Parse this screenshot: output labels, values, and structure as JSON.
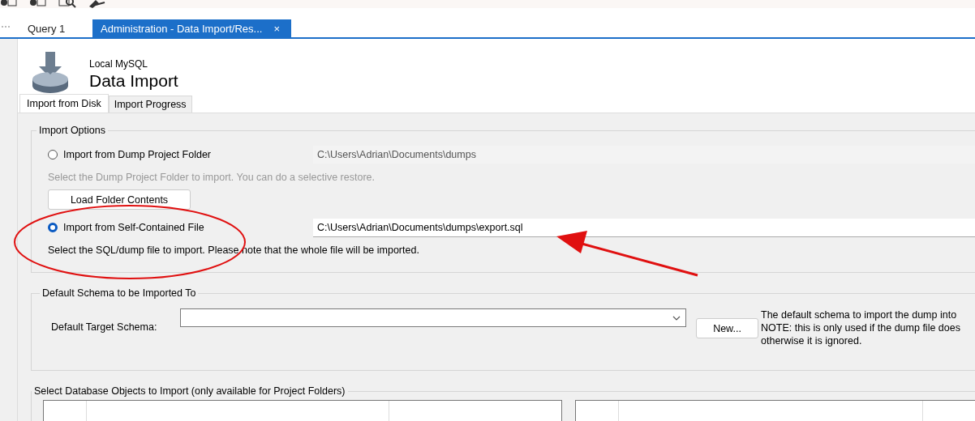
{
  "tabs": [
    {
      "label": "Query 1",
      "selected": false
    },
    {
      "label": "Administration - Data Import/Res...",
      "selected": true,
      "close": "×"
    }
  ],
  "header": {
    "connection": "Local MySQL",
    "title": "Data Import"
  },
  "subtabs": [
    {
      "label": "Import from Disk",
      "selected": true
    },
    {
      "label": "Import Progress",
      "selected": false
    }
  ],
  "import_options": {
    "title": "Import Options",
    "options": [
      {
        "label": "Import from Dump Project Folder",
        "selected": false,
        "path": "C:\\Users\\Adrian\\Documents\\dumps",
        "hint": "Select the Dump Project Folder to import. You can do a selective restore.",
        "button": "Load Folder Contents"
      },
      {
        "label": "Import from Self-Contained File",
        "selected": true,
        "path": "C:\\Users\\Adrian\\Documents\\dumps\\export.sql",
        "hint": "Select the SQL/dump file to import. Please note that the whole file will be imported."
      }
    ]
  },
  "default_schema": {
    "title": "Default Schema to be Imported To",
    "label": "Default Target Schema:",
    "button": "New...",
    "note": [
      "The default schema to import the dump into",
      "NOTE: this is only used if the dump file does",
      "otherwise it is ignored."
    ]
  },
  "objects": {
    "title": "Select Database Objects to Import (only available for Project Folders)"
  }
}
